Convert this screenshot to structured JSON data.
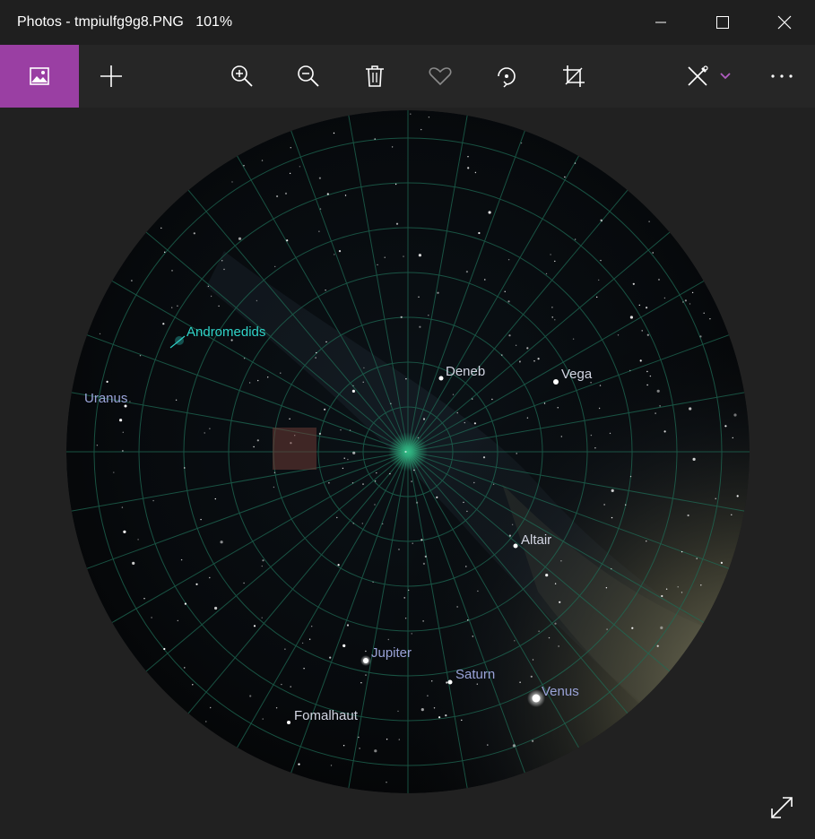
{
  "window": {
    "app": "Photos",
    "separator": " - ",
    "filename": "tmpiulfg9g8.PNG",
    "zoom": "101%"
  },
  "toolbar": {
    "items": [
      {
        "name": "collection-button",
        "icon": "picture-icon"
      },
      {
        "name": "add-button",
        "icon": "plus-icon"
      },
      {
        "name": "zoom-in-button",
        "icon": "zoom-in-icon"
      },
      {
        "name": "zoom-out-button",
        "icon": "zoom-out-icon"
      },
      {
        "name": "delete-button",
        "icon": "trash-icon"
      },
      {
        "name": "favorite-button",
        "icon": "heart-icon"
      },
      {
        "name": "rotate-button",
        "icon": "rotate-icon"
      },
      {
        "name": "crop-button",
        "icon": "crop-icon"
      },
      {
        "name": "edit-create-button",
        "icon": "pen-edit-icon"
      },
      {
        "name": "more-button",
        "icon": "ellipsis-icon"
      }
    ],
    "accent": "#9a3fa3"
  },
  "sky": {
    "labels": [
      {
        "text": "Andromedids",
        "kind": "meteor-shower"
      },
      {
        "text": "Uranus",
        "kind": "planet"
      },
      {
        "text": "Deneb",
        "kind": "star"
      },
      {
        "text": "Vega",
        "kind": "star"
      },
      {
        "text": "Altair",
        "kind": "star"
      },
      {
        "text": "Jupiter",
        "kind": "planet"
      },
      {
        "text": "Saturn",
        "kind": "planet"
      },
      {
        "text": "Venus",
        "kind": "planet"
      },
      {
        "text": "Fomalhaut",
        "kind": "star"
      }
    ],
    "colors": {
      "grid": "#1f6b55",
      "star_label": "#d3d6e3",
      "planet_label": "#9aa3d8",
      "shower_label": "#2fd3c8"
    }
  }
}
